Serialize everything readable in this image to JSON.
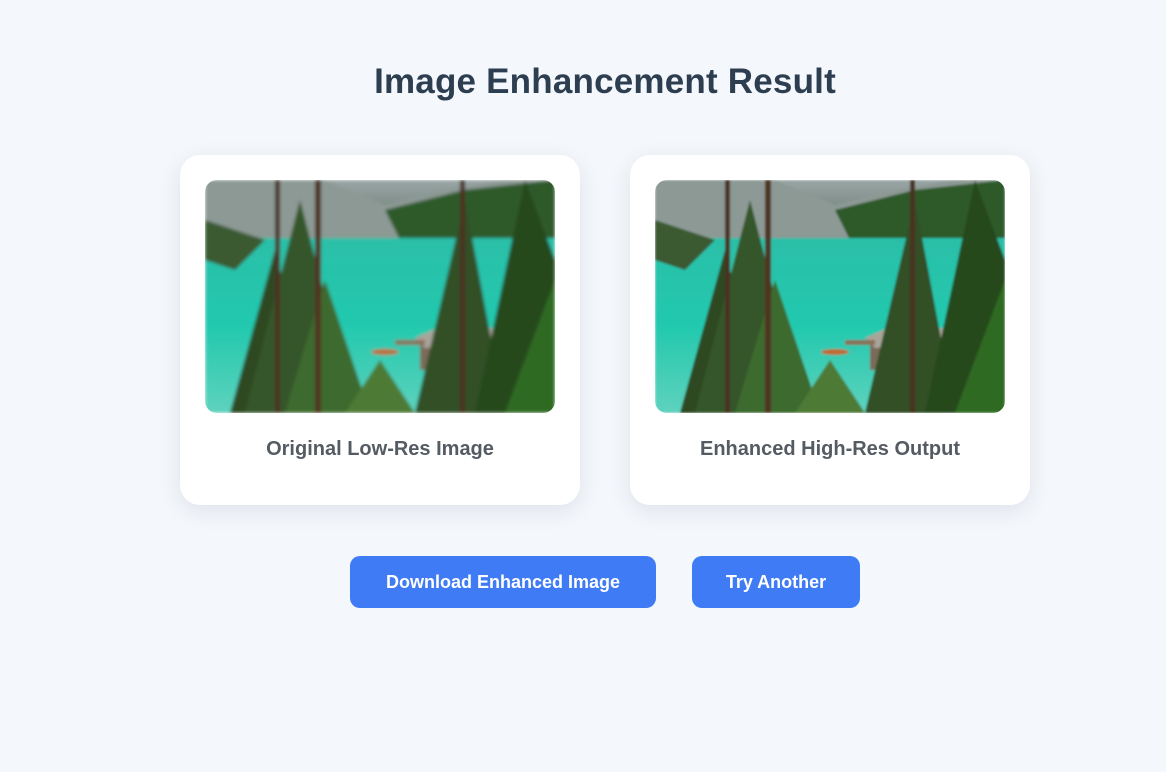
{
  "page": {
    "title": "Image Enhancement Result"
  },
  "cards": {
    "original": {
      "caption": "Original Low-Res Image"
    },
    "enhanced": {
      "caption": "Enhanced High-Res Output"
    }
  },
  "actions": {
    "download_label": "Download Enhanced Image",
    "try_again_label": "Try Another"
  },
  "colors": {
    "background": "#f4f7fb",
    "card": "#ffffff",
    "accent": "#3f7bf5",
    "title": "#2c3e50",
    "caption": "#555b63"
  }
}
